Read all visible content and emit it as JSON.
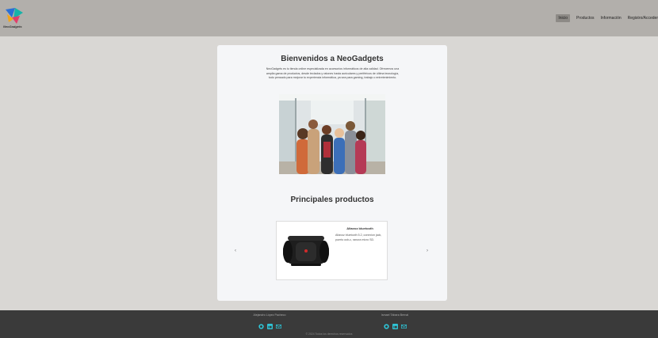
{
  "header": {
    "logo_text": "NeoGadgets",
    "nav": [
      {
        "label": "Inicio",
        "active": true
      },
      {
        "label": "Productos",
        "active": false
      },
      {
        "label": "Información",
        "active": false
      },
      {
        "label": "Registro/Acceder",
        "active": false
      }
    ]
  },
  "main": {
    "welcome_title": "Bienvenidos a NeoGadgets",
    "intro": "NeoGadgets es tu tienda online especializada en accesorios informáticos de alta calidad. Ofrecemos una amplia gama de productos, desde teclados y ratones hasta auriculares y periféricos de última tecnología, todo pensado para mejorar tu experiencia informática, ya sea para gaming, trabajo o entretenimiento.",
    "products_title": "Principales productos",
    "prev_arrow": "‹",
    "next_arrow": "›",
    "featured_product": {
      "name": "Altavoz bluetooth",
      "description": "Altavoz bluetooth 5.2, conexion jack, puerto usb-c, ranura micro SD."
    }
  },
  "footer": {
    "authors": [
      {
        "name": "Alejandro López Pacheco"
      },
      {
        "name": "Ismael Tábara Bernal"
      }
    ],
    "copyright": "© 2024 Todos los derechos reservados"
  },
  "colors": {
    "header_bg": "#b2afab",
    "body_bg": "#d9d7d4",
    "footer_bg": "#3a3a3a",
    "social_icon": "#2ec4d6"
  }
}
